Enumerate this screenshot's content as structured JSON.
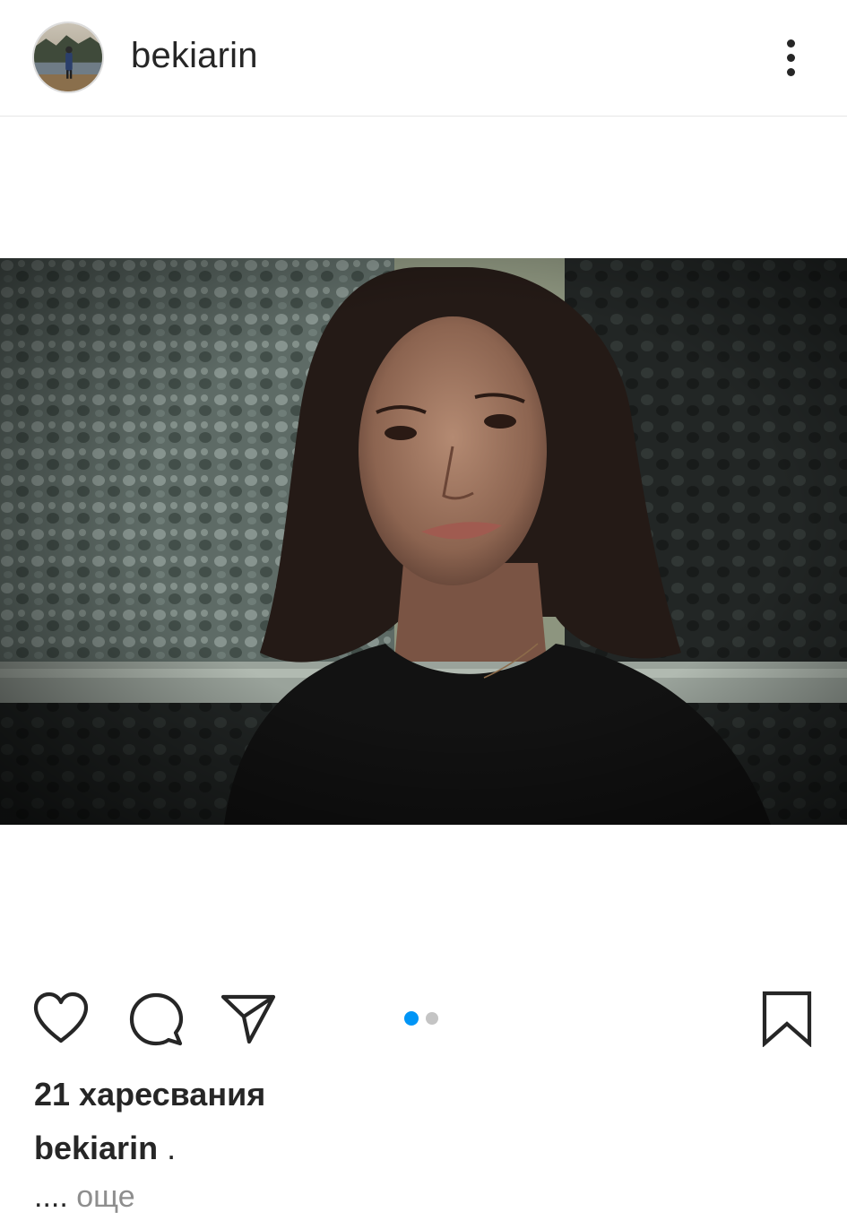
{
  "header": {
    "username": "bekiarin",
    "avatar_icon": "avatar-photo",
    "more_icon": "more-vertical-icon"
  },
  "media": {
    "description_icon": "post-photo",
    "carousel_count": 2,
    "carousel_active_index": 0
  },
  "actions": {
    "like_icon": "heart-icon",
    "comment_icon": "comment-bubble-icon",
    "share_icon": "paper-plane-icon",
    "save_icon": "bookmark-icon"
  },
  "likes_text": "21 харесвания",
  "caption": {
    "username": "bekiarin",
    "text": "."
  },
  "more_row": {
    "ellipsis": "....",
    "more_label": "още"
  },
  "colors": {
    "accent": "#0095f6",
    "text": "#262626",
    "muted": "#8e8e8e",
    "inactive_dot": "#c4c4c4"
  }
}
